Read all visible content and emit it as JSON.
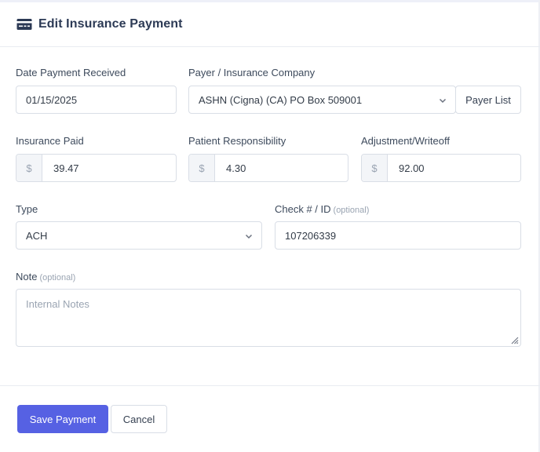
{
  "modal": {
    "title": "Edit Insurance Payment",
    "icon": "credit-card-icon"
  },
  "form": {
    "date_received": {
      "label": "Date Payment Received",
      "value": "01/15/2025"
    },
    "payer": {
      "label": "Payer / Insurance Company",
      "value": "ASHN (Cigna) (CA) PO Box 509001",
      "button": "Payer List"
    },
    "insurance_paid": {
      "label": "Insurance Paid",
      "prefix": "$",
      "value": "39.47"
    },
    "patient_responsibility": {
      "label": "Patient Responsibility",
      "prefix": "$",
      "value": "4.30"
    },
    "adjustment": {
      "label": "Adjustment/Writeoff",
      "prefix": "$",
      "value": "92.00"
    },
    "type": {
      "label": "Type",
      "value": "ACH"
    },
    "check": {
      "label": "Check # / ID",
      "optional": "(optional)",
      "value": "107206339"
    },
    "note": {
      "label": "Note",
      "optional": "(optional)",
      "placeholder": "Internal Notes"
    }
  },
  "footer": {
    "save": "Save Payment",
    "cancel": "Cancel"
  },
  "colors": {
    "primary": "#5661e3",
    "title": "#2c3a55",
    "border": "#d9dee6"
  }
}
